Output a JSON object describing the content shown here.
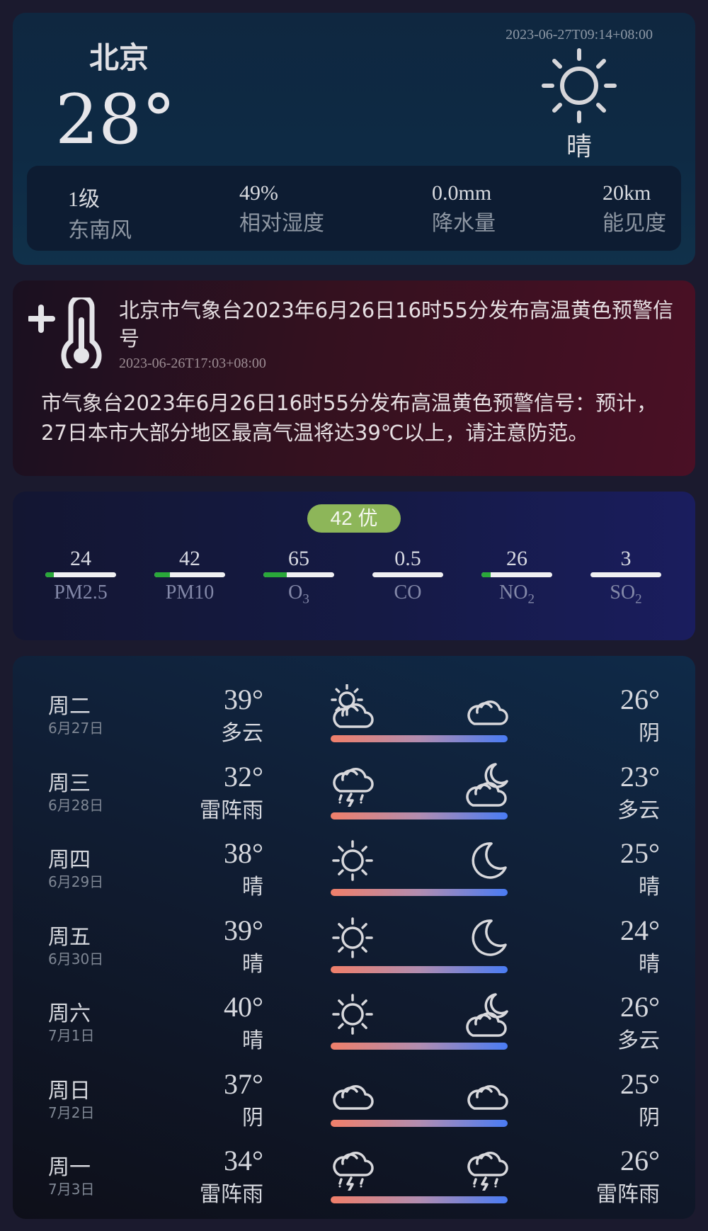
{
  "current": {
    "city": "北京",
    "temperature": "28°",
    "time": "2023-06-27T09:14+08:00",
    "condition": "晴",
    "icon": "sun-icon",
    "stats": [
      {
        "value": "1级",
        "label": "东南风"
      },
      {
        "value": "49%",
        "label": "相对湿度"
      },
      {
        "value": "0.0mm",
        "label": "降水量"
      },
      {
        "value": "20km",
        "label": "能见度"
      }
    ]
  },
  "alert": {
    "icon": "thermometer-plus-icon",
    "title": "北京市气象台2023年6月26日16时55分发布高温黄色预警信号",
    "time": "2023-06-26T17:03+08:00",
    "body": "市气象台2023年6月26日16时55分发布高温黄色预警信号：预计，27日本市大部分地区最高气温将达39℃以上，请注意防范。"
  },
  "aqi": {
    "badge": "42 优",
    "badge_color": "#8db659",
    "bar_color": "#2aa83a",
    "pollutants": [
      {
        "value": "24",
        "name": "PM2.5",
        "sub": "",
        "level": 0.12
      },
      {
        "value": "42",
        "name": "PM10",
        "sub": "",
        "level": 0.22
      },
      {
        "value": "65",
        "name": "O",
        "sub": "3",
        "level": 0.33
      },
      {
        "value": "0.5",
        "name": "CO",
        "sub": "",
        "level": 0.0
      },
      {
        "value": "26",
        "name": "NO",
        "sub": "2",
        "level": 0.13
      },
      {
        "value": "3",
        "name": "SO",
        "sub": "2",
        "level": 0.0
      }
    ]
  },
  "forecast": [
    {
      "day": "周二",
      "date": "6月27日",
      "high": "39°",
      "day_cond": "多云",
      "day_icon": "partly-cloudy-day-icon",
      "low": "26°",
      "night_cond": "阴",
      "night_icon": "overcast-icon"
    },
    {
      "day": "周三",
      "date": "6月28日",
      "high": "32°",
      "day_cond": "雷阵雨",
      "day_icon": "thunderstorm-icon",
      "low": "23°",
      "night_cond": "多云",
      "night_icon": "partly-cloudy-night-icon"
    },
    {
      "day": "周四",
      "date": "6月29日",
      "high": "38°",
      "day_cond": "晴",
      "day_icon": "sun-icon",
      "low": "25°",
      "night_cond": "晴",
      "night_icon": "moon-icon"
    },
    {
      "day": "周五",
      "date": "6月30日",
      "high": "39°",
      "day_cond": "晴",
      "day_icon": "sun-icon",
      "low": "24°",
      "night_cond": "晴",
      "night_icon": "moon-icon"
    },
    {
      "day": "周六",
      "date": "7月1日",
      "high": "40°",
      "day_cond": "晴",
      "day_icon": "sun-icon",
      "low": "26°",
      "night_cond": "多云",
      "night_icon": "partly-cloudy-night-icon"
    },
    {
      "day": "周日",
      "date": "7月2日",
      "high": "37°",
      "day_cond": "阴",
      "day_icon": "overcast-icon",
      "low": "25°",
      "night_cond": "阴",
      "night_icon": "overcast-icon"
    },
    {
      "day": "周一",
      "date": "7月3日",
      "high": "34°",
      "day_cond": "雷阵雨",
      "day_icon": "thunderstorm-icon",
      "low": "26°",
      "night_cond": "雷阵雨",
      "night_icon": "thunderstorm-icon"
    }
  ]
}
